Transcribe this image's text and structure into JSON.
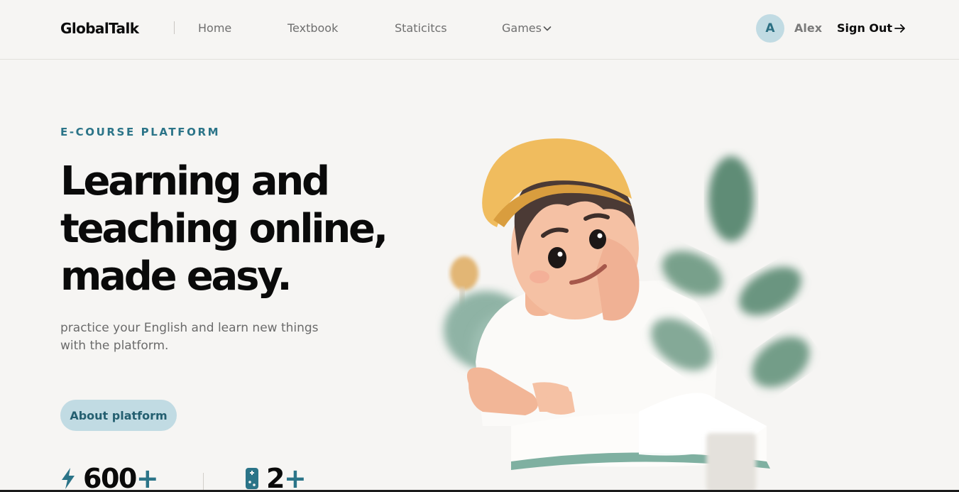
{
  "header": {
    "logo": "GlobalTalk",
    "nav": [
      {
        "label": "Home"
      },
      {
        "label": "Textbook"
      },
      {
        "label": "Staticitcs"
      },
      {
        "label": "Games"
      }
    ],
    "user": {
      "initial": "A",
      "name": "Alex"
    },
    "signout_label": "Sign Out"
  },
  "hero": {
    "eyebrow": "E-COURSE PLATFORM",
    "headline_lines": [
      "Learning and",
      "teaching online,",
      "made easy."
    ],
    "subtitle": "practice your English and learn new things with the platform.",
    "cta_label": "About platform"
  },
  "stats": [
    {
      "value": "600",
      "suffix": "+",
      "icon": "lightning-icon"
    },
    {
      "value": "2",
      "suffix": "+",
      "icon": "gamepad-icon"
    }
  ],
  "colors": {
    "accent": "#2b7488",
    "accent_light": "#c1dbe3",
    "background": "#f6f5f3"
  }
}
